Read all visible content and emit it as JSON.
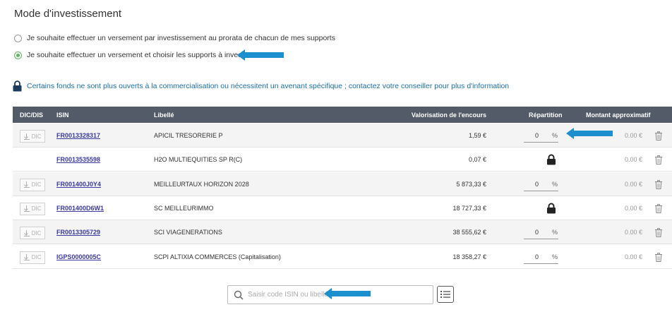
{
  "title": "Mode d'investissement",
  "options": [
    {
      "label": "Je souhaite effectuer un versement par investissement au prorata de chacun de mes supports",
      "checked": false
    },
    {
      "label": "Je souhaite effectuer un versement et choisir les supports à investir",
      "checked": true
    }
  ],
  "info_text": "Certains fonds ne sont plus ouverts à la commercialisation ou nécessitent un avenant spécifique ; contactez votre conseiller pour plus d'information",
  "table": {
    "headers": {
      "dic": "DIC/DIS",
      "isin": "ISIN",
      "libelle": "Libellé",
      "valorisation": "Valorisation de l'encours",
      "repartition": "Répartition",
      "montant": "Montant approximatif"
    },
    "dic_label": "DIC",
    "rows": [
      {
        "isin": "FR0013328317",
        "libelle": "APICIL TRESORERIE P",
        "valorisation": "1,59 €",
        "repartition": "0",
        "pct": "%",
        "montant": "0.00 €",
        "has_dic": true,
        "locked": false
      },
      {
        "isin": "FR0013535598",
        "libelle": "H2O MULTIEQUITIES SP R(C)",
        "valorisation": "0,07 €",
        "repartition": "",
        "pct": "",
        "montant": "0.00 €",
        "has_dic": false,
        "locked": true
      },
      {
        "isin": "FR001400J0Y4",
        "libelle": "MEILLEURTAUX HORIZON 2028",
        "valorisation": "5 873,33 €",
        "repartition": "0",
        "pct": "%",
        "montant": "0.00 €",
        "has_dic": true,
        "locked": false
      },
      {
        "isin": "FR001400D6W1",
        "libelle": "SC MEILLEURIMMO",
        "valorisation": "18 727,33 €",
        "repartition": "",
        "pct": "",
        "montant": "0.00 €",
        "has_dic": true,
        "locked": true
      },
      {
        "isin": "FR0013305729",
        "libelle": "SCI VIAGENERATIONS",
        "valorisation": "38 555,62 €",
        "repartition": "0",
        "pct": "%",
        "montant": "0.00 €",
        "has_dic": true,
        "locked": false
      },
      {
        "isin": "IGPS0000005C",
        "libelle": "SCPI ALTIXIA COMMERCES (Capitalisation)",
        "valorisation": "18 358,27 €",
        "repartition": "0",
        "pct": "%",
        "montant": "0.00 €",
        "has_dic": true,
        "locked": false
      }
    ]
  },
  "search": {
    "placeholder": "Saisir code ISIN ou libellé",
    "value": ""
  },
  "icons": {
    "search": "search-icon",
    "list": "list-icon",
    "lock": "lock-icon",
    "trash": "trash-icon",
    "download": "download-icon",
    "arrow": "arrow-left-icon"
  },
  "colors": {
    "accent": "#1c8fcf",
    "radio_checked": "#5cb85c",
    "header_bg": "#525b67",
    "isin_link": "#3b3aa0",
    "info_text": "#1b6fa8"
  }
}
